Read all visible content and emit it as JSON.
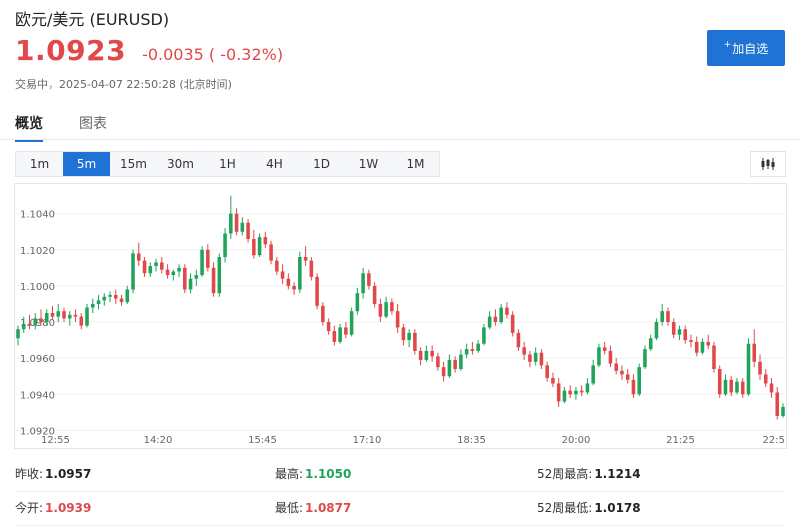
{
  "header": {
    "title": "欧元/美元 (EURUSD)",
    "price": "1.0923",
    "change": "-0.0035",
    "change_pct": "( -0.32%)",
    "status": "交易中",
    "timestamp": "2025-04-07 22:50:28 (北京时间)",
    "add_watchlist": "加自选"
  },
  "tabs": [
    {
      "label": "概览",
      "active": true
    },
    {
      "label": "图表",
      "active": false
    }
  ],
  "periods": [
    {
      "label": "1m",
      "active": false
    },
    {
      "label": "5m",
      "active": true
    },
    {
      "label": "15m",
      "active": false
    },
    {
      "label": "30m",
      "active": false
    },
    {
      "label": "1H",
      "active": false
    },
    {
      "label": "4H",
      "active": false
    },
    {
      "label": "1D",
      "active": false
    },
    {
      "label": "1W",
      "active": false
    },
    {
      "label": "1M",
      "active": false
    }
  ],
  "chart_data": {
    "type": "candlestick",
    "y_ticks": [
      "1.1040",
      "1.1020",
      "1.1000",
      "1.0980",
      "1.0960",
      "1.0940",
      "1.0920"
    ],
    "x_ticks": [
      "12:55",
      "14:20",
      "15:45",
      "17:10",
      "18:35",
      "20:00",
      "21:25",
      "22:5"
    ],
    "ylim": [
      1.0918,
      1.1052
    ],
    "up_color": "#20a35a",
    "down_color": "#e0484a",
    "ohlc": [
      [
        1.0971,
        1.0978,
        1.0967,
        1.0976
      ],
      [
        1.0976,
        1.0983,
        1.0974,
        1.0979
      ],
      [
        1.0979,
        1.0984,
        1.0976,
        1.0978
      ],
      [
        1.0978,
        1.0985,
        1.0976,
        1.0982
      ],
      [
        1.0982,
        1.0987,
        1.0978,
        1.098
      ],
      [
        1.098,
        1.0987,
        1.0978,
        1.0985
      ],
      [
        1.0985,
        1.0989,
        1.0981,
        1.0983
      ],
      [
        1.0983,
        1.099,
        1.098,
        1.0986
      ],
      [
        1.0986,
        1.0988,
        1.098,
        1.0982
      ],
      [
        1.0982,
        1.0986,
        1.0978,
        1.0984
      ],
      [
        1.0984,
        1.0987,
        1.098,
        1.0983
      ],
      [
        1.0983,
        1.0985,
        1.0976,
        1.0978
      ],
      [
        1.0978,
        1.099,
        1.0977,
        1.0988
      ],
      [
        1.0988,
        1.0993,
        1.0985,
        1.099
      ],
      [
        1.099,
        1.0995,
        1.0987,
        1.0992
      ],
      [
        1.0992,
        1.0996,
        1.0989,
        1.0994
      ],
      [
        1.0994,
        1.0997,
        1.0991,
        1.0995
      ],
      [
        1.0995,
        1.0998,
        1.099,
        1.0993
      ],
      [
        1.0993,
        1.0995,
        1.0989,
        1.0991
      ],
      [
        1.0991,
        1.1,
        1.099,
        1.0998
      ],
      [
        1.0998,
        1.102,
        1.0996,
        1.1018
      ],
      [
        1.1018,
        1.1024,
        1.1011,
        1.1014
      ],
      [
        1.1014,
        1.1016,
        1.1005,
        1.1007
      ],
      [
        1.1007,
        1.1013,
        1.1005,
        1.1011
      ],
      [
        1.1011,
        1.1015,
        1.1008,
        1.1013
      ],
      [
        1.1013,
        1.1016,
        1.1007,
        1.1009
      ],
      [
        1.1009,
        1.1012,
        1.1004,
        1.1006
      ],
      [
        1.1006,
        1.1009,
        1.1003,
        1.1008
      ],
      [
        1.1008,
        1.1012,
        1.1005,
        1.101
      ],
      [
        1.101,
        1.1012,
        1.0996,
        1.0998
      ],
      [
        1.0998,
        1.1007,
        1.0996,
        1.1004
      ],
      [
        1.1004,
        1.1009,
        1.1,
        1.1006
      ],
      [
        1.1006,
        1.1022,
        1.1005,
        1.102
      ],
      [
        1.102,
        1.1023,
        1.1008,
        1.101
      ],
      [
        1.101,
        1.1013,
        1.0994,
        1.0996
      ],
      [
        1.0996,
        1.1018,
        1.0994,
        1.1016
      ],
      [
        1.1016,
        1.1032,
        1.1013,
        1.1029
      ],
      [
        1.1029,
        1.105,
        1.1026,
        1.104
      ],
      [
        1.104,
        1.1043,
        1.1028,
        1.103
      ],
      [
        1.103,
        1.1038,
        1.1028,
        1.1035
      ],
      [
        1.1035,
        1.1037,
        1.1024,
        1.1026
      ],
      [
        1.1026,
        1.1031,
        1.1015,
        1.1017
      ],
      [
        1.1017,
        1.1029,
        1.1016,
        1.1027
      ],
      [
        1.1027,
        1.103,
        1.1021,
        1.1023
      ],
      [
        1.1023,
        1.1025,
        1.1012,
        1.1014
      ],
      [
        1.1014,
        1.1016,
        1.1006,
        1.1008
      ],
      [
        1.1008,
        1.1012,
        1.1001,
        1.1004
      ],
      [
        1.1004,
        1.1007,
        1.0998,
        1.1
      ],
      [
        1.1,
        1.1002,
        1.0995,
        1.0998
      ],
      [
        1.0998,
        1.1019,
        1.0996,
        1.1016
      ],
      [
        1.1016,
        1.1022,
        1.1011,
        1.1014
      ],
      [
        1.1014,
        1.1016,
        1.1003,
        1.1005
      ],
      [
        1.1005,
        1.1007,
        1.0987,
        1.0989
      ],
      [
        1.0989,
        1.0991,
        1.0978,
        1.098
      ],
      [
        1.098,
        1.0982,
        1.0973,
        1.0975
      ],
      [
        1.0975,
        1.0978,
        1.0967,
        1.0969
      ],
      [
        1.0969,
        1.0979,
        1.0968,
        1.0977
      ],
      [
        1.0977,
        1.098,
        1.0971,
        1.0973
      ],
      [
        1.0973,
        1.0988,
        1.0972,
        1.0986
      ],
      [
        1.0986,
        1.0999,
        1.0984,
        1.0996
      ],
      [
        1.0996,
        1.101,
        1.0993,
        1.1007
      ],
      [
        1.1007,
        1.1009,
        1.0998,
        1.1
      ],
      [
        1.1,
        1.1002,
        1.0988,
        1.099
      ],
      [
        1.099,
        1.0993,
        1.098,
        1.0983
      ],
      [
        1.0983,
        1.0994,
        1.0982,
        1.0991
      ],
      [
        1.0991,
        1.0993,
        1.0984,
        1.0986
      ],
      [
        1.0986,
        1.099,
        1.0974,
        1.0977
      ],
      [
        1.0977,
        1.0979,
        1.0967,
        1.097
      ],
      [
        1.097,
        1.0976,
        1.0966,
        1.0974
      ],
      [
        1.0974,
        1.0976,
        1.0962,
        1.0964
      ],
      [
        1.0964,
        1.0966,
        1.0956,
        1.0959
      ],
      [
        1.0959,
        1.0967,
        1.0958,
        1.0964
      ],
      [
        1.0964,
        1.0967,
        1.0958,
        1.0961
      ],
      [
        1.0961,
        1.0963,
        1.0953,
        1.0955
      ],
      [
        1.0955,
        1.0958,
        1.0947,
        1.095
      ],
      [
        1.095,
        1.0962,
        1.0949,
        1.0959
      ],
      [
        1.0959,
        1.0961,
        1.0952,
        1.0954
      ],
      [
        1.0954,
        1.0965,
        1.0953,
        1.0962
      ],
      [
        1.0962,
        1.0968,
        1.096,
        1.0965
      ],
      [
        1.0965,
        1.0969,
        1.0962,
        1.0964
      ],
      [
        1.0964,
        1.097,
        1.0963,
        1.0968
      ],
      [
        1.0968,
        1.0979,
        1.0967,
        1.0977
      ],
      [
        1.0977,
        1.0986,
        1.0976,
        1.0983
      ],
      [
        1.0983,
        1.0987,
        1.0978,
        1.098
      ],
      [
        1.098,
        1.099,
        1.0979,
        1.0988
      ],
      [
        1.0988,
        1.0991,
        1.0982,
        1.0984
      ],
      [
        1.0984,
        1.0986,
        1.0972,
        1.0974
      ],
      [
        1.0974,
        1.0976,
        1.0964,
        1.0966
      ],
      [
        1.0966,
        1.0969,
        1.0959,
        1.0962
      ],
      [
        1.0962,
        1.0964,
        1.0955,
        1.0958
      ],
      [
        1.0958,
        1.0966,
        1.0956,
        1.0963
      ],
      [
        1.0963,
        1.0965,
        1.0954,
        1.0956
      ],
      [
        1.0956,
        1.0958,
        1.0947,
        1.0949
      ],
      [
        1.0949,
        1.0952,
        1.0944,
        1.0946
      ],
      [
        1.0946,
        1.0949,
        1.0933,
        1.0936
      ],
      [
        1.0936,
        1.0944,
        1.0935,
        1.0942
      ],
      [
        1.0942,
        1.0945,
        1.0938,
        1.094
      ],
      [
        1.094,
        1.0944,
        1.0937,
        1.0942
      ],
      [
        1.0942,
        1.0945,
        1.0939,
        1.0941
      ],
      [
        1.0941,
        1.0949,
        1.094,
        1.0946
      ],
      [
        1.0946,
        1.0959,
        1.0945,
        1.0956
      ],
      [
        1.0956,
        1.0968,
        1.0955,
        1.0966
      ],
      [
        1.0966,
        1.0969,
        1.0962,
        1.0964
      ],
      [
        1.0964,
        1.0967,
        1.0955,
        1.0957
      ],
      [
        1.0957,
        1.096,
        1.0951,
        1.0953
      ],
      [
        1.0953,
        1.0956,
        1.0948,
        1.0951
      ],
      [
        1.0951,
        1.0954,
        1.0946,
        1.0948
      ],
      [
        1.0948,
        1.0951,
        1.0938,
        1.094
      ],
      [
        1.094,
        1.0957,
        1.0939,
        1.0955
      ],
      [
        1.0955,
        1.0967,
        1.0954,
        1.0965
      ],
      [
        1.0965,
        1.0973,
        1.0964,
        1.0971
      ],
      [
        1.0971,
        1.0982,
        1.097,
        1.098
      ],
      [
        1.098,
        1.099,
        1.0978,
        1.0986
      ],
      [
        1.0986,
        1.0988,
        1.0978,
        1.098
      ],
      [
        1.098,
        1.0982,
        1.0971,
        1.0973
      ],
      [
        1.0973,
        1.0978,
        1.097,
        1.0976
      ],
      [
        1.0976,
        1.0978,
        1.0968,
        1.097
      ],
      [
        1.097,
        1.0973,
        1.0966,
        1.0969
      ],
      [
        1.0969,
        1.0972,
        1.0961,
        1.0963
      ],
      [
        1.0963,
        1.0971,
        1.0962,
        1.0969
      ],
      [
        1.0969,
        1.0973,
        1.0965,
        1.0967
      ],
      [
        1.0967,
        1.0969,
        1.0952,
        1.0954
      ],
      [
        1.0954,
        1.0956,
        1.0938,
        1.094
      ],
      [
        1.094,
        1.0951,
        1.0939,
        1.0948
      ],
      [
        1.0948,
        1.095,
        1.0939,
        1.0941
      ],
      [
        1.0941,
        1.0949,
        1.094,
        1.0947
      ],
      [
        1.0947,
        1.0949,
        1.0938,
        1.094
      ],
      [
        1.094,
        1.0971,
        1.0939,
        1.0968
      ],
      [
        1.0968,
        1.0976,
        1.0955,
        1.0958
      ],
      [
        1.0958,
        1.0962,
        1.0948,
        1.0951
      ],
      [
        1.0951,
        1.0954,
        1.0944,
        1.0946
      ],
      [
        1.0946,
        1.0949,
        1.0938,
        1.0941
      ],
      [
        1.0941,
        1.0944,
        1.0926,
        1.0928
      ],
      [
        1.0928,
        1.0935,
        1.0927,
        1.0933
      ]
    ]
  },
  "stats": {
    "prev_close": {
      "label": "昨收:",
      "value": "1.0957"
    },
    "open": {
      "label": "今开:",
      "value": "1.0939"
    },
    "high": {
      "label": "最高:",
      "value": "1.1050"
    },
    "low": {
      "label": "最低:",
      "value": "1.0877"
    },
    "high52": {
      "label": "52周最高:",
      "value": "1.1214"
    },
    "low52": {
      "label": "52周最低:",
      "value": "1.0178"
    }
  }
}
